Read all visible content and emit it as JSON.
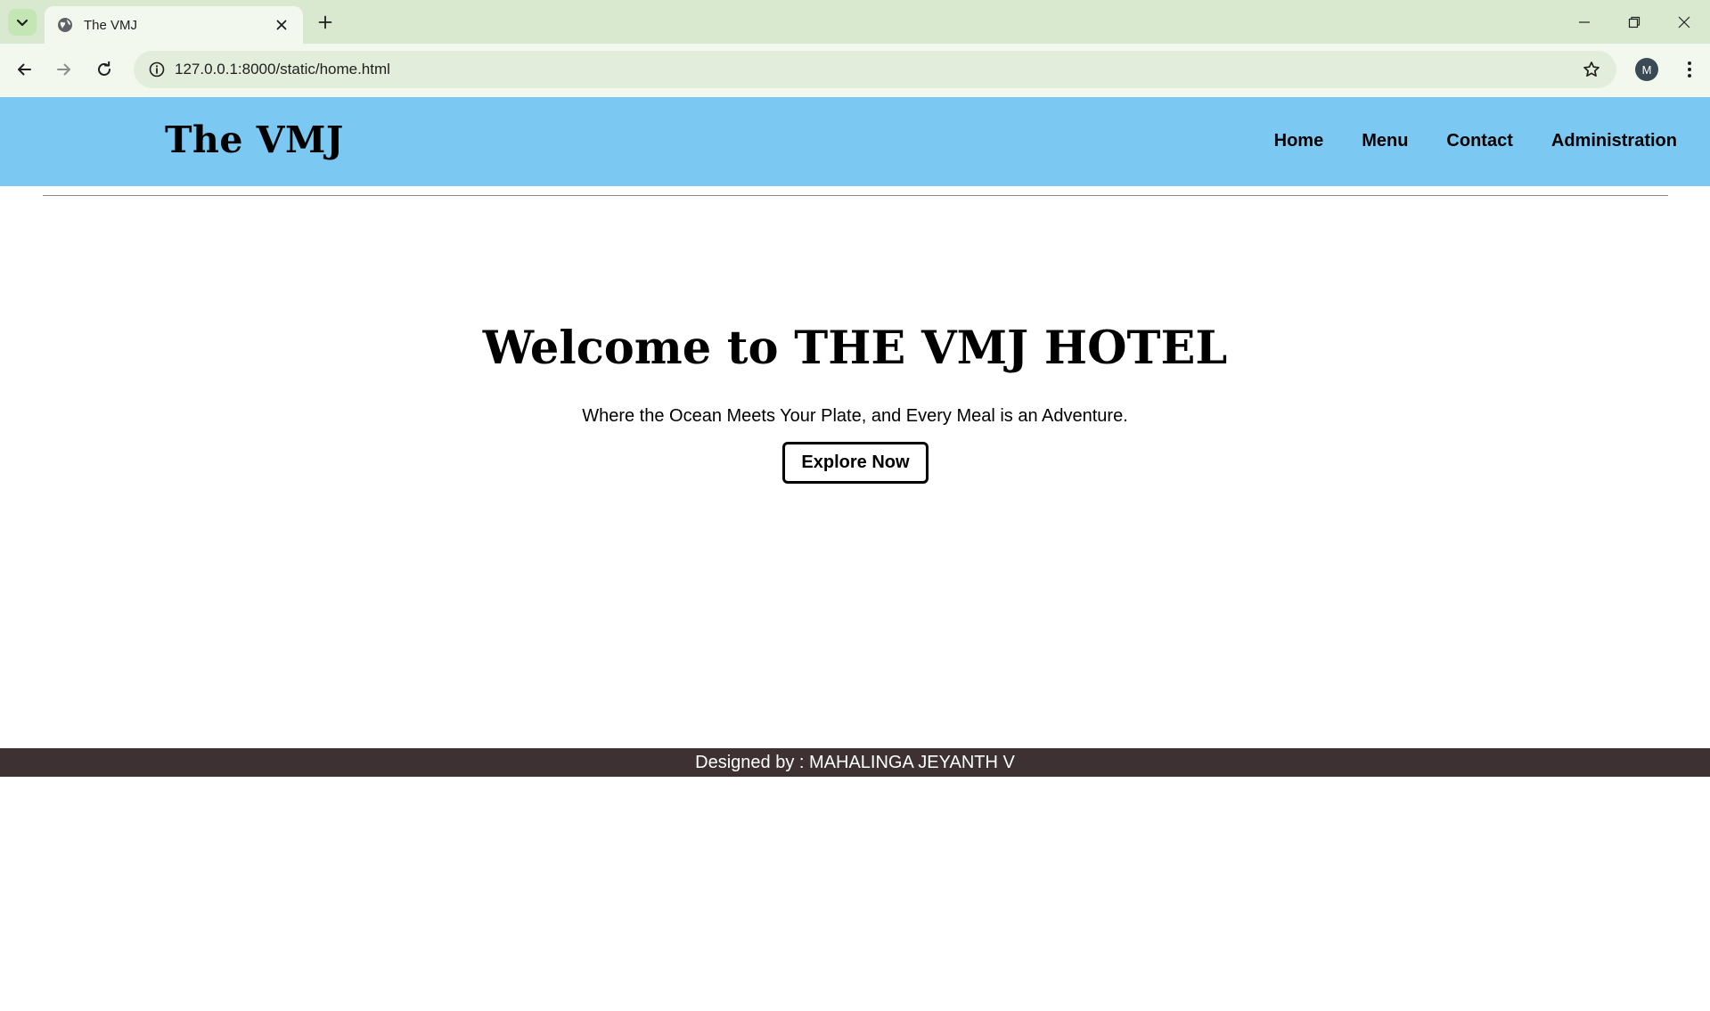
{
  "browser": {
    "tab_title": "The VMJ",
    "url": "127.0.0.1:8000/static/home.html",
    "profile_initial": "M"
  },
  "header": {
    "brand": "The VMJ",
    "nav": [
      "Home",
      "Menu",
      "Contact",
      "Administration"
    ],
    "background_color": "#7bc9f3"
  },
  "hero": {
    "title": "Welcome to THE VMJ HOTEL",
    "subtitle": "Where the Ocean Meets Your Plate, and Every Meal is an Adventure.",
    "cta_label": "Explore Now"
  },
  "footer": {
    "text": "Designed by : MAHALINGA JEYANTH V",
    "background_color": "#3d3133"
  },
  "icons": [
    "tab-search-icon",
    "globe-icon",
    "close-icon",
    "plus-icon",
    "minimize-icon",
    "restore-icon",
    "window-close-icon",
    "back-arrow-icon",
    "forward-arrow-icon",
    "reload-icon",
    "site-info-icon",
    "star-icon",
    "kebab-menu-icon"
  ]
}
